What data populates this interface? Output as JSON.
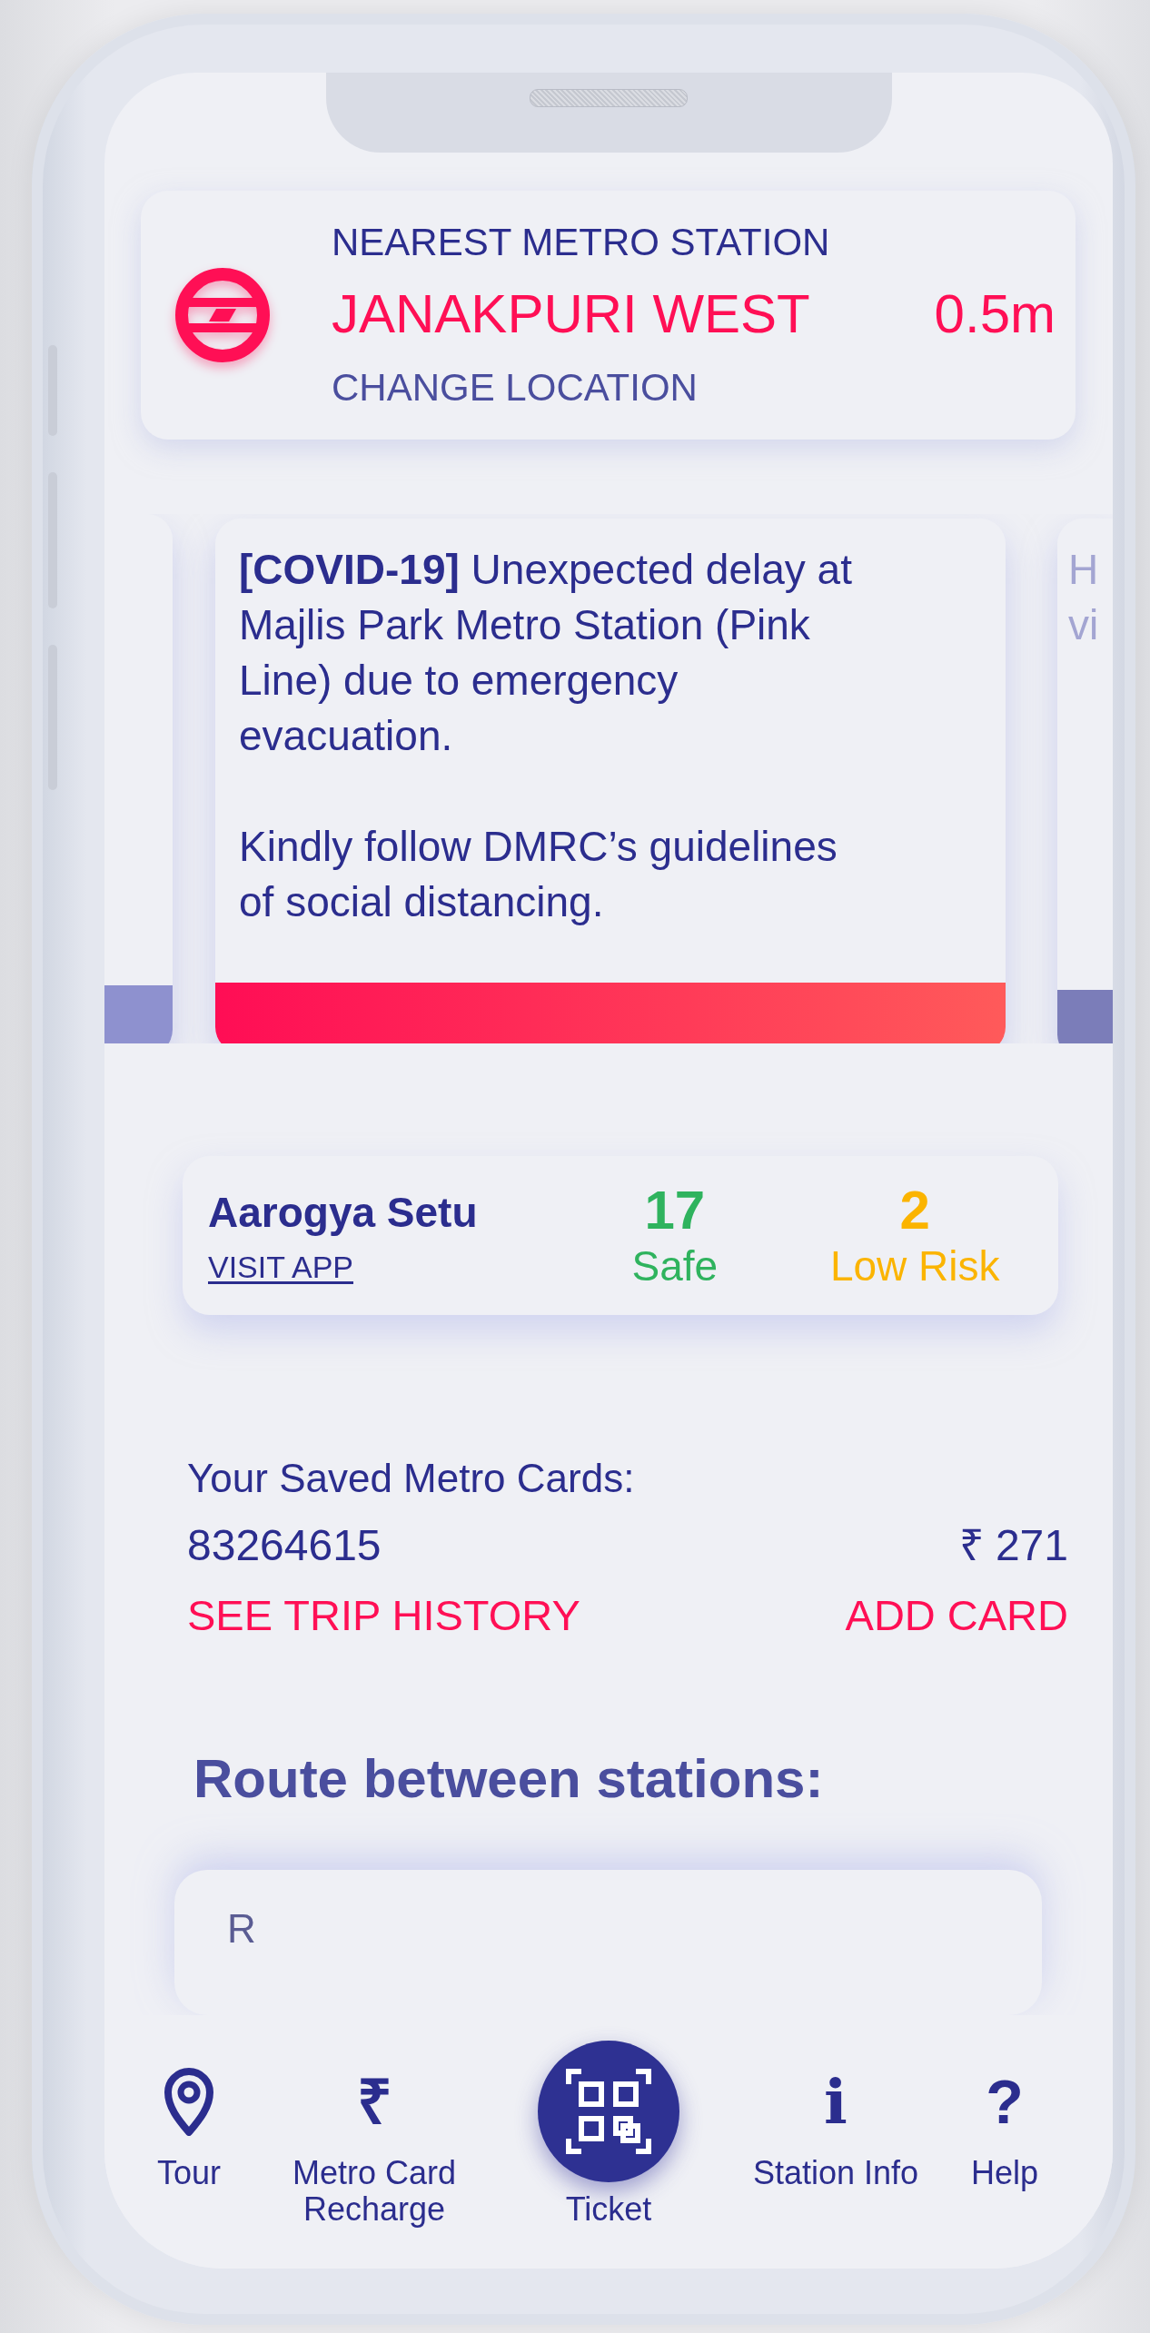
{
  "station_card": {
    "heading": "NEAREST METRO STATION",
    "station": "JANAKPURI WEST",
    "distance": "0.5m",
    "action": "CHANGE LOCATION"
  },
  "alerts": [
    {
      "kind": "peek",
      "color": "#8e91cf"
    },
    {
      "kind": "full",
      "color": "#ff0d55",
      "paragraphs": [
        "**[COVID-19]** Unexpected delay at Majlis Park Metro Station (Pink Line) due to emergency evacuation.",
        "Kindly follow DMRC’s guidelines of social distancing."
      ]
    },
    {
      "kind": "peek",
      "color": "#7b7db9",
      "lines": [
        "H",
        "vi"
      ]
    }
  ],
  "setu": {
    "title": "Aarogya Setu",
    "link": "VISIT APP",
    "stats": [
      {
        "value": "17",
        "label": "Safe",
        "color": "#2fb35e"
      },
      {
        "value": "2",
        "label": "Low Risk",
        "color": "#fbb400"
      }
    ]
  },
  "saved_cards": {
    "heading": "Your Saved Metro Cards:",
    "card_number": "83264615",
    "balance": "₹ 271",
    "history_link": "SEE TRIP HISTORY",
    "add_link": "ADD CARD"
  },
  "route": {
    "heading": "Route between stations:",
    "value": "R"
  },
  "nav": [
    {
      "label": "Tour",
      "kind": "tab"
    },
    {
      "label": "Metro Card Recharge",
      "kind": "tab",
      "glyph": "₹"
    },
    {
      "label": "Ticket",
      "kind": "fab"
    },
    {
      "label": "Station Info",
      "kind": "tab",
      "glyph": "i"
    },
    {
      "label": "Help",
      "kind": "tab",
      "glyph": "?"
    }
  ]
}
